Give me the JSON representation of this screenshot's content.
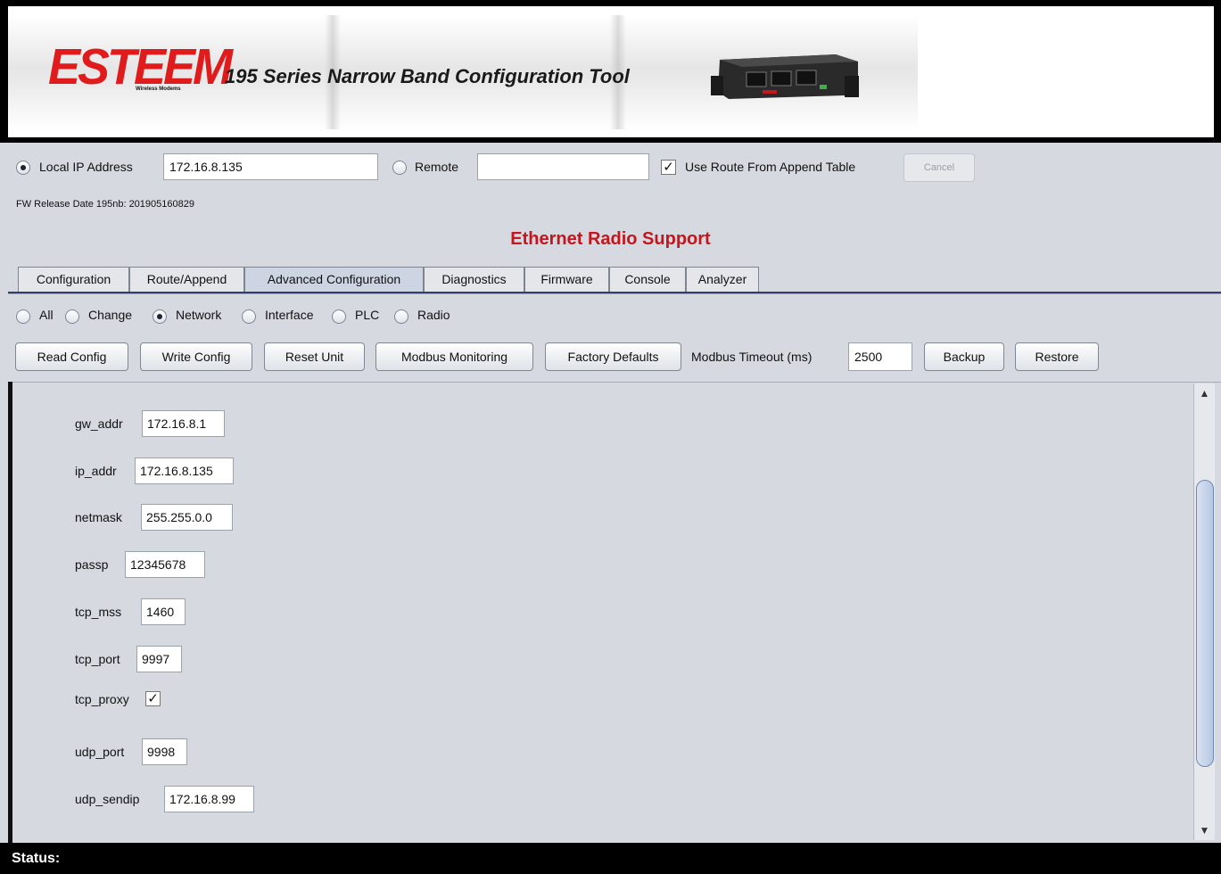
{
  "banner": {
    "logo_text": "ESTEEM",
    "logo_subtext": "Wireless Modems",
    "title": "195 Series Narrow Band Configuration Tool"
  },
  "connection": {
    "local_label": "Local IP Address",
    "local_selected": true,
    "local_ip_value": "172.16.8.135",
    "remote_label": "Remote",
    "remote_selected": false,
    "remote_value": "",
    "use_route_label": "Use Route From Append Table",
    "use_route_checked": true,
    "cancel_label": "Cancel"
  },
  "fw_release": "FW Release Date 195nb: 201905160829",
  "section_title": "Ethernet Radio Support",
  "tabs": [
    {
      "label": "Configuration",
      "active": false
    },
    {
      "label": "Route/Append",
      "active": false
    },
    {
      "label": "Advanced Configuration",
      "active": true
    },
    {
      "label": "Diagnostics",
      "active": false
    },
    {
      "label": "Firmware",
      "active": false
    },
    {
      "label": "Console",
      "active": false
    },
    {
      "label": "Analyzer",
      "active": false
    }
  ],
  "filters": [
    {
      "label": "All",
      "selected": false
    },
    {
      "label": "Change",
      "selected": false
    },
    {
      "label": "Network",
      "selected": true
    },
    {
      "label": "Interface",
      "selected": false
    },
    {
      "label": "PLC",
      "selected": false
    },
    {
      "label": "Radio",
      "selected": false
    }
  ],
  "toolbar": {
    "read_config": "Read Config",
    "write_config": "Write Config",
    "reset_unit": "Reset Unit",
    "modbus_monitoring": "Modbus Monitoring",
    "factory_defaults": "Factory Defaults",
    "modbus_timeout_label": "Modbus Timeout (ms)",
    "modbus_timeout_value": "2500",
    "backup": "Backup",
    "restore": "Restore"
  },
  "fields": {
    "gw_addr": {
      "label": "gw_addr",
      "value": "172.16.8.1"
    },
    "ip_addr": {
      "label": "ip_addr",
      "value": "172.16.8.135"
    },
    "netmask": {
      "label": "netmask",
      "value": "255.255.0.0"
    },
    "passp": {
      "label": "passp",
      "value": "12345678"
    },
    "tcp_mss": {
      "label": "tcp_mss",
      "value": "1460"
    },
    "tcp_port": {
      "label": "tcp_port",
      "value": "9997"
    },
    "tcp_proxy": {
      "label": "tcp_proxy",
      "checked": true
    },
    "udp_port": {
      "label": "udp_port",
      "value": "9998"
    },
    "udp_sendip": {
      "label": "udp_sendip",
      "value": "172.16.8.99"
    }
  },
  "status_label": "Status:",
  "colors": {
    "accent_red": "#c4161c",
    "logo_red": "#e01b1b",
    "tab_underline": "#30406a"
  }
}
